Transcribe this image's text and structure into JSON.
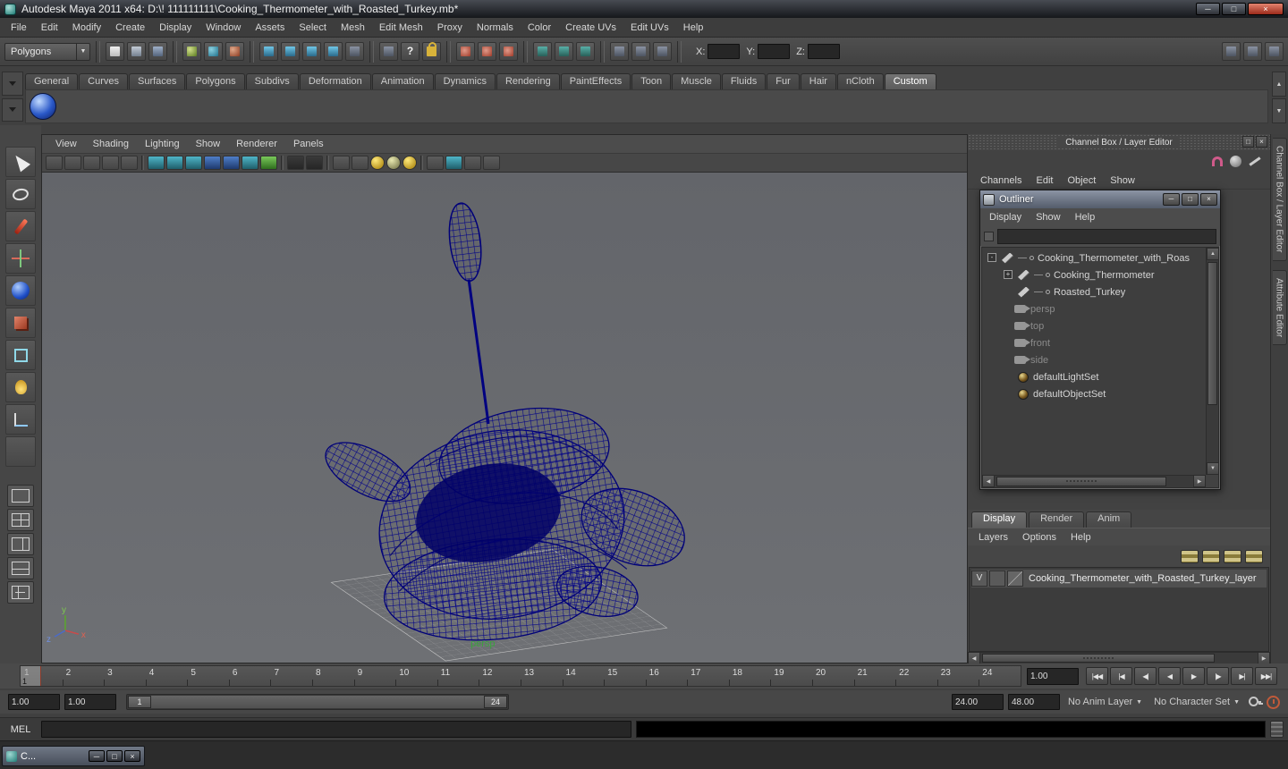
{
  "icons": {
    "minimize": "─",
    "maximize": "□",
    "close": "×",
    "dropdown": "▼",
    "tri_up": "▲",
    "tri_down": "▼",
    "tri_left": "◀",
    "tri_right": "▶",
    "help": "?",
    "collapse": "-",
    "expand": "+",
    "playback": [
      "|◀◀",
      "|◀",
      "◀|",
      "◀",
      "▶",
      "|▶",
      "▶|",
      "▶▶|"
    ]
  },
  "titlebar": {
    "title": "Autodesk Maya 2011 x64: D:\\! 111111111\\Cooking_Thermometer_with_Roasted_Turkey.mb*"
  },
  "menubar": {
    "items": [
      "File",
      "Edit",
      "Modify",
      "Create",
      "Display",
      "Window",
      "Assets",
      "Select",
      "Mesh",
      "Edit Mesh",
      "Proxy",
      "Normals",
      "Color",
      "Create UVs",
      "Edit UVs",
      "Help"
    ]
  },
  "statusline": {
    "mode": "Polygons",
    "x_label": "X:",
    "y_label": "Y:",
    "z_label": "Z:",
    "x_value": "",
    "y_value": "",
    "z_value": ""
  },
  "shelf": {
    "tabs": [
      "General",
      "Curves",
      "Surfaces",
      "Polygons",
      "Subdivs",
      "Deformation",
      "Animation",
      "Dynamics",
      "Rendering",
      "PaintEffects",
      "Toon",
      "Muscle",
      "Fluids",
      "Fur",
      "Hair",
      "nCloth",
      "Custom"
    ]
  },
  "viewport": {
    "menus": [
      "View",
      "Shading",
      "Lighting",
      "Show",
      "Renderer",
      "Panels"
    ],
    "camera_label": "persp",
    "axis_x": "x",
    "axis_y": "y",
    "axis_z": "z"
  },
  "channel_box": {
    "header": "Channel Box / Layer Editor",
    "menus": [
      "Channels",
      "Edit",
      "Object",
      "Show"
    ]
  },
  "outliner": {
    "title": "Outliner",
    "menus": [
      "Display",
      "Show",
      "Help"
    ],
    "search_value": "",
    "items": [
      {
        "label": "Cooking_Thermometer_with_Roas"
      },
      {
        "label": "Cooking_Thermometer"
      },
      {
        "label": "Roasted_Turkey"
      },
      {
        "label": "persp"
      },
      {
        "label": "top"
      },
      {
        "label": "front"
      },
      {
        "label": "side"
      },
      {
        "label": "defaultLightSet"
      },
      {
        "label": "defaultObjectSet"
      }
    ]
  },
  "layer_editor": {
    "tabs": [
      "Display",
      "Render",
      "Anim"
    ],
    "menus": [
      "Layers",
      "Options",
      "Help"
    ],
    "layer": {
      "visibility": "V",
      "name": "Cooking_Thermometer_with_Roasted_Turkey_layer"
    }
  },
  "side_tabs": [
    "Channel Box / Layer Editor",
    "Attribute Editor"
  ],
  "timeline": {
    "frames": [
      "1",
      "2",
      "3",
      "4",
      "5",
      "6",
      "7",
      "8",
      "9",
      "10",
      "11",
      "12",
      "13",
      "14",
      "15",
      "16",
      "17",
      "18",
      "19",
      "20",
      "21",
      "22",
      "23",
      "24"
    ],
    "current_frame": "1",
    "current_time": "1.00"
  },
  "range_slider": {
    "anim_start": "1.00",
    "playback_start": "1.00",
    "handle_start": "1",
    "handle_end": "24",
    "playback_end": "24.00",
    "anim_end": "48.00",
    "anim_layer": "No Anim Layer",
    "character_set": "No Character Set"
  },
  "command_line": {
    "label": "MEL",
    "input_value": ""
  },
  "taskbar": {
    "minimized_title": "C..."
  }
}
